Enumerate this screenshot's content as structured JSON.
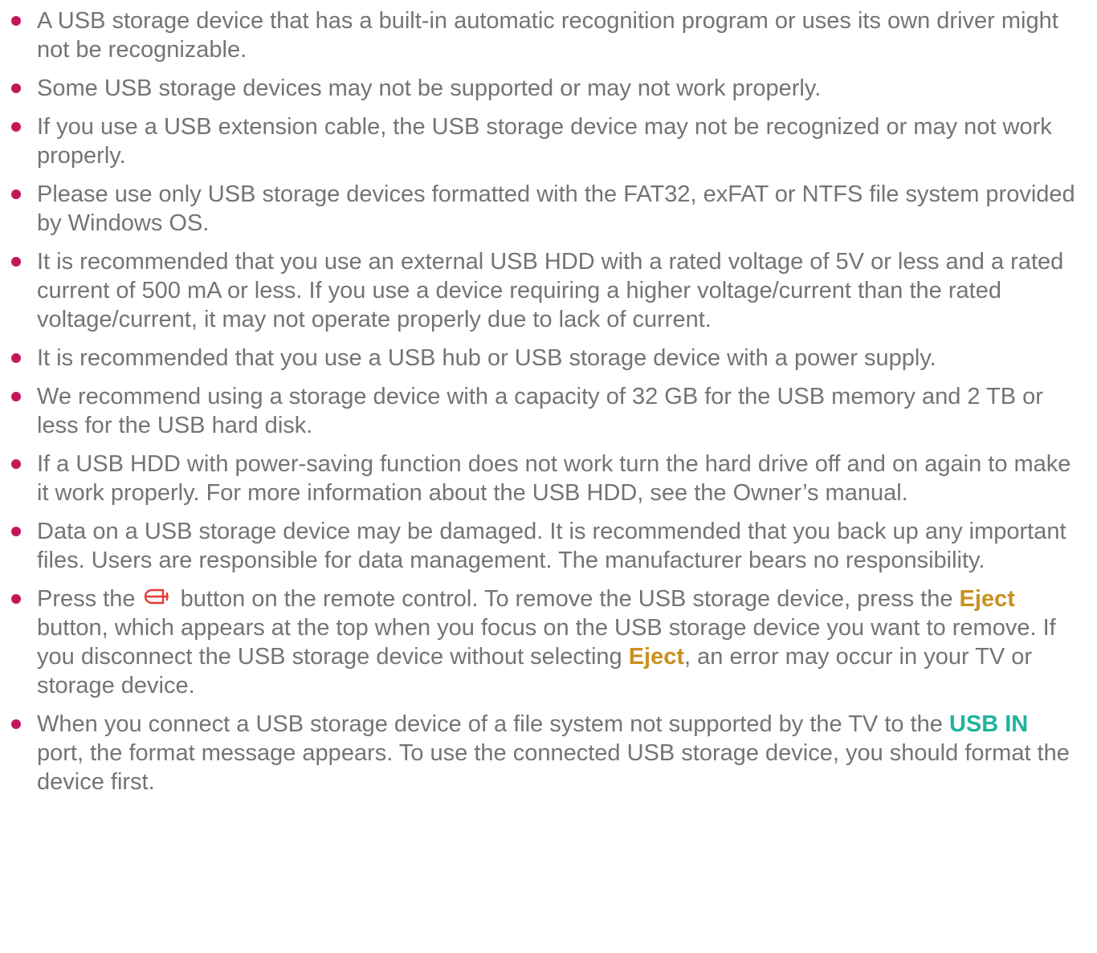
{
  "colors": {
    "bullet": "#c2185b",
    "body_text": "#747474",
    "keyword_gold": "#c8901e",
    "keyword_teal": "#1fb49c",
    "icon_red": "#e53935"
  },
  "notes": [
    {
      "text": "A USB storage device that has a built-in automatic recognition program or uses its own driver might not be recognizable."
    },
    {
      "text": "Some USB storage devices may not be supported or may not work properly."
    },
    {
      "text": "If you use a USB extension cable, the USB storage device may not be recognized or may not work properly."
    },
    {
      "text": "Please use only USB storage devices formatted with the FAT32, exFAT or NTFS file system provided by Windows OS."
    },
    {
      "text": "It is recommended that you use an external USB HDD with a rated voltage of 5V or less and a rated current of 500 mA or less. If you use a device requiring a higher voltage/current than the rated voltage/current, it may not operate properly due to lack of current."
    },
    {
      "text": "It is recommended that you use a USB hub or USB storage device with a power supply."
    },
    {
      "text": "We recommend using a storage device with a capacity of 32 GB for the USB memory and 2 TB or less for the USB hard disk."
    },
    {
      "text": "If a USB HDD with power-saving function does not work turn the hard drive off and on again to make it work properly. For more information about the USB HDD, see the Owner’s manual."
    },
    {
      "text": "Data on a USB storage device may be damaged. It is recommended that you back up any important files. Users are responsible for data management. The manufacturer bears no responsibility."
    },
    {
      "icon": "input-source-icon",
      "part1": "Press the",
      "part2": "button on the remote control. To remove the USB storage device, press the",
      "kw1": "Eject",
      "part3": "button, which appears at the top when you focus on the USB storage device you want to remove. If you disconnect the USB storage device without selecting",
      "kw2": "Eject",
      "part4": ", an error may occur in your TV or storage device."
    },
    {
      "part1": "When you connect a USB storage device of a file system not supported by the TV to the",
      "kw": "USB IN",
      "part2": "port, the format message appears. To use the connected USB storage device, you should format the device first."
    }
  ]
}
